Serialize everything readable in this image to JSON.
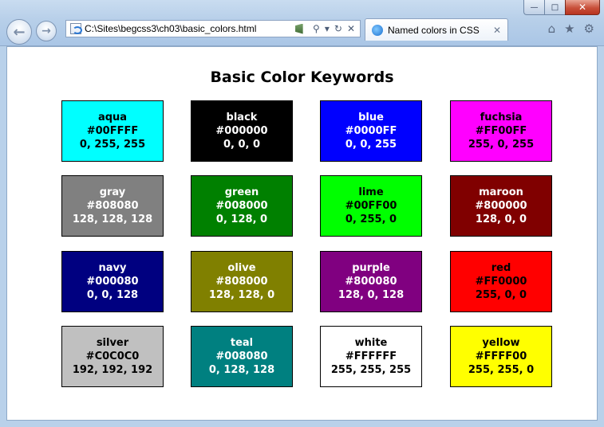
{
  "window": {
    "minimize_glyph": "—",
    "maximize_glyph": "□",
    "close_glyph": "✕"
  },
  "nav": {
    "back_glyph": "←",
    "forward_glyph": "→",
    "back_icon": "back-arrow-icon",
    "forward_icon": "forward-arrow-icon"
  },
  "address": {
    "url": "C:\\Sites\\begcss3\\ch03\\basic_colors.html",
    "search_glyph": "⚲",
    "dropdown_glyph": "▾",
    "refresh_glyph": "↻",
    "stop_glyph": "✕"
  },
  "tab": {
    "title": "Named colors in CSS",
    "close_glyph": "✕"
  },
  "toolbar": {
    "home_glyph": "⌂",
    "favorites_glyph": "★",
    "tools_glyph": "⚙"
  },
  "page": {
    "title": "Basic Color Keywords"
  },
  "colors": [
    {
      "name": "aqua",
      "hex": "#00FFFF",
      "rgb": "0, 255, 255",
      "bg": "#00FFFF",
      "fg": "#000000"
    },
    {
      "name": "black",
      "hex": "#000000",
      "rgb": "0, 0, 0",
      "bg": "#000000",
      "fg": "#FFFFFF"
    },
    {
      "name": "blue",
      "hex": "#0000FF",
      "rgb": "0, 0, 255",
      "bg": "#0000FF",
      "fg": "#FFFFFF"
    },
    {
      "name": "fuchsia",
      "hex": "#FF00FF",
      "rgb": "255, 0, 255",
      "bg": "#FF00FF",
      "fg": "#000000"
    },
    {
      "name": "gray",
      "hex": "#808080",
      "rgb": "128, 128, 128",
      "bg": "#808080",
      "fg": "#FFFFFF"
    },
    {
      "name": "green",
      "hex": "#008000",
      "rgb": "0, 128, 0",
      "bg": "#008000",
      "fg": "#FFFFFF"
    },
    {
      "name": "lime",
      "hex": "#00FF00",
      "rgb": "0, 255, 0",
      "bg": "#00FF00",
      "fg": "#000000"
    },
    {
      "name": "maroon",
      "hex": "#800000",
      "rgb": "128, 0, 0",
      "bg": "#800000",
      "fg": "#FFFFFF"
    },
    {
      "name": "navy",
      "hex": "#000080",
      "rgb": "0, 0, 128",
      "bg": "#000080",
      "fg": "#FFFFFF"
    },
    {
      "name": "olive",
      "hex": "#808000",
      "rgb": "128, 128, 0",
      "bg": "#808000",
      "fg": "#FFFFFF"
    },
    {
      "name": "purple",
      "hex": "#800080",
      "rgb": "128, 0, 128",
      "bg": "#800080",
      "fg": "#FFFFFF"
    },
    {
      "name": "red",
      "hex": "#FF0000",
      "rgb": "255, 0, 0",
      "bg": "#FF0000",
      "fg": "#000000"
    },
    {
      "name": "silver",
      "hex": "#C0C0C0",
      "rgb": "192, 192, 192",
      "bg": "#C0C0C0",
      "fg": "#000000"
    },
    {
      "name": "teal",
      "hex": "#008080",
      "rgb": "0, 128, 128",
      "bg": "#008080",
      "fg": "#FFFFFF"
    },
    {
      "name": "white",
      "hex": "#FFFFFF",
      "rgb": "255, 255, 255",
      "bg": "#FFFFFF",
      "fg": "#000000"
    },
    {
      "name": "yellow",
      "hex": "#FFFF00",
      "rgb": "255, 255, 0",
      "bg": "#FFFF00",
      "fg": "#000000"
    }
  ]
}
